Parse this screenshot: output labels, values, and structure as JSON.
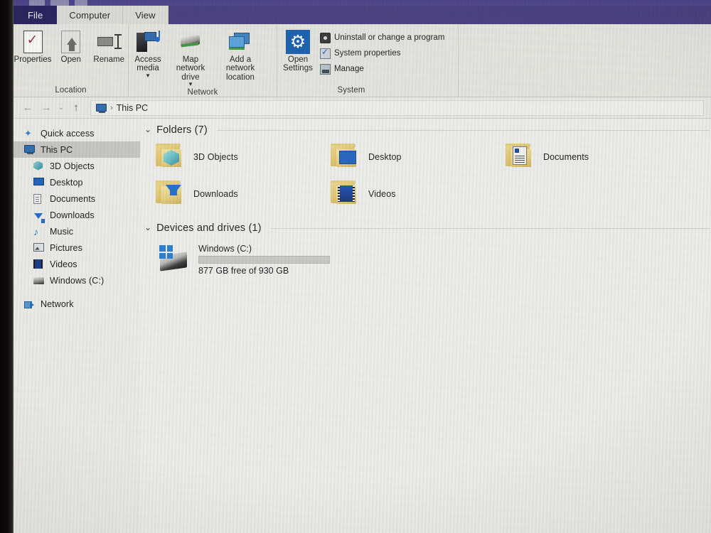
{
  "window": {
    "app": "File Explorer",
    "tabs": [
      {
        "label": "File",
        "name": "tab-file"
      },
      {
        "label": "Computer",
        "name": "tab-computer"
      },
      {
        "label": "View",
        "name": "tab-view"
      }
    ],
    "active_tab": "Computer"
  },
  "ribbon": {
    "groups": [
      {
        "title": "Location",
        "buttons": [
          {
            "label": "Properties",
            "icon": "properties-icon"
          },
          {
            "label": "Open",
            "icon": "open-icon"
          },
          {
            "label": "Rename",
            "icon": "rename-icon"
          }
        ]
      },
      {
        "title": "Network",
        "buttons": [
          {
            "label": "Access media",
            "icon": "access-media-icon",
            "dropdown": true
          },
          {
            "label": "Map network drive",
            "icon": "map-network-drive-icon",
            "dropdown": true
          },
          {
            "label": "Add a network location",
            "icon": "add-network-location-icon",
            "dropdown": false
          }
        ]
      },
      {
        "title": "System",
        "buttons": [
          {
            "label": "Open Settings",
            "icon": "settings-gear-icon"
          }
        ],
        "small_items": [
          {
            "label": "Uninstall or change a program",
            "icon": "uninstall-program-icon"
          },
          {
            "label": "System properties",
            "icon": "system-properties-icon"
          },
          {
            "label": "Manage",
            "icon": "manage-icon"
          }
        ]
      }
    ]
  },
  "addressbar": {
    "back": "←",
    "forward": "→",
    "recent": "⌄",
    "up": "↑",
    "breadcrumb_icon": "this-pc-icon",
    "separator": "›",
    "crumb": "This PC"
  },
  "navpane": {
    "items": [
      {
        "label": "Quick access",
        "icon": "star-icon",
        "level": "root",
        "selected": false
      },
      {
        "label": "This PC",
        "icon": "this-pc-icon",
        "level": "root",
        "selected": true
      },
      {
        "label": "3D Objects",
        "icon": "3d-objects-icon",
        "level": "child",
        "selected": false
      },
      {
        "label": "Desktop",
        "icon": "desktop-icon",
        "level": "child",
        "selected": false
      },
      {
        "label": "Documents",
        "icon": "documents-icon",
        "level": "child",
        "selected": false
      },
      {
        "label": "Downloads",
        "icon": "downloads-icon",
        "level": "child",
        "selected": false
      },
      {
        "label": "Music",
        "icon": "music-icon",
        "level": "child",
        "selected": false
      },
      {
        "label": "Pictures",
        "icon": "pictures-icon",
        "level": "child",
        "selected": false
      },
      {
        "label": "Videos",
        "icon": "videos-icon",
        "level": "child",
        "selected": false
      },
      {
        "label": "Windows (C:)",
        "icon": "windows-drive-icon",
        "level": "child",
        "selected": false
      },
      {
        "label": "Network",
        "icon": "network-icon",
        "level": "root",
        "selected": false,
        "spaced": true
      }
    ]
  },
  "content": {
    "sections": [
      {
        "chevron": "⌄",
        "title": "Folders (7)",
        "name": "section-folders"
      },
      {
        "chevron": "⌄",
        "title": "Devices and drives (1)",
        "name": "section-devices"
      }
    ],
    "folders": [
      {
        "label": "3D Objects",
        "icon": "folder-3d-objects-icon"
      },
      {
        "label": "Desktop",
        "icon": "folder-desktop-icon"
      },
      {
        "label": "Documents",
        "icon": "folder-documents-icon"
      },
      {
        "label": "Downloads",
        "icon": "folder-downloads-icon"
      },
      {
        "label": "Videos",
        "icon": "folder-videos-icon"
      }
    ],
    "drives": [
      {
        "name": "Windows (C:)",
        "free_text": "877 GB free of 930 GB",
        "free_gb": 877,
        "total_gb": 930,
        "used_percent": 6,
        "icon": "windows-drive-icon",
        "bar_color": "#1a62b5"
      }
    ]
  },
  "colors": {
    "desktop_purple": "#4b4486",
    "file_tab": "#2b2663",
    "ribbon_bg": "#e6e6e0",
    "selection": "#c8c8c4",
    "accent_blue": "#1763b7"
  }
}
